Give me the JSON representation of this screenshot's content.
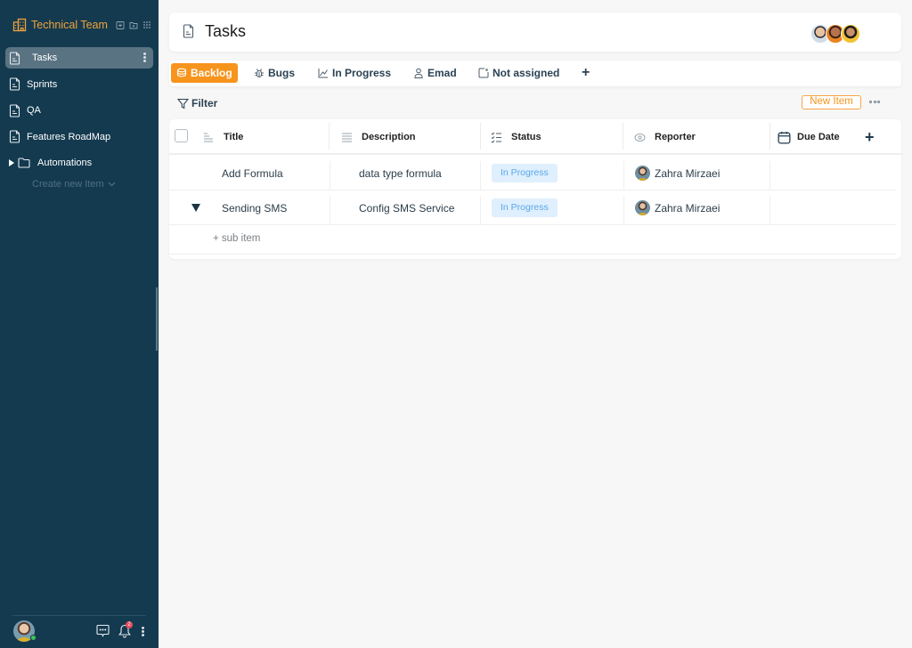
{
  "sidebar": {
    "team_name": "Technical Team",
    "items": [
      {
        "label": "Tasks",
        "icon": "document-icon",
        "active": true
      },
      {
        "label": "Sprints",
        "icon": "document-icon"
      },
      {
        "label": "QA",
        "icon": "document-icon"
      },
      {
        "label": "Features RoadMap",
        "icon": "document-icon"
      },
      {
        "label": "Automations",
        "icon": "folder-icon"
      }
    ],
    "create_new_label": "Create new Item",
    "notification_count": "2"
  },
  "header": {
    "title": "Tasks"
  },
  "tabs": [
    {
      "label": "Backlog",
      "icon": "stack-icon",
      "active": true
    },
    {
      "label": "Bugs",
      "icon": "bug-icon"
    },
    {
      "label": "In Progress",
      "icon": "chart-icon"
    },
    {
      "label": "Emad",
      "icon": "user-icon"
    },
    {
      "label": "Not assigned",
      "icon": "unassigned-icon"
    }
  ],
  "toolbar": {
    "filter_label": "Filter",
    "new_item_label": "New Item"
  },
  "table": {
    "columns": [
      "Title",
      "Description",
      "Status",
      "Reporter",
      "Due Date"
    ],
    "rows": [
      {
        "title": "Add Formula",
        "description": "data type formula",
        "status": "In Progress",
        "reporter": "Zahra Mirzaei",
        "due_date": ""
      },
      {
        "title": "Sending SMS",
        "description": "Config SMS Service",
        "status": "In Progress",
        "reporter": "Zahra Mirzaei",
        "due_date": ""
      }
    ],
    "sub_item_label": "+ sub item"
  },
  "colors": {
    "sidebar_bg": "#143a4f",
    "accent": "#f7941d",
    "status_bg": "#dfeffd",
    "status_text": "#5aa8e8"
  }
}
